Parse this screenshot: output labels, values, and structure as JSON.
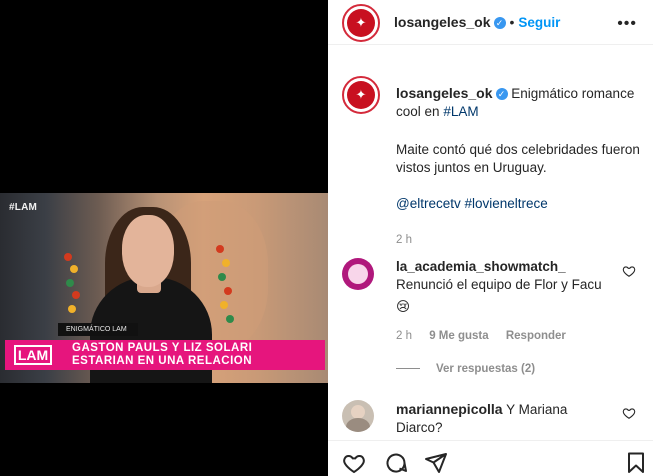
{
  "video": {
    "corner_tag": "#LAM",
    "caption_small": "ENIGMÁTICO LAM",
    "logo_text": "LAM",
    "headline_line1": "GASTON PAULS Y LIZ SOLARI",
    "headline_line2": "ESTARIAN EN UNA RELACION",
    "accent_color": "#e6157d"
  },
  "header": {
    "username": "losangeles_ok",
    "follow_label": "Seguir",
    "more_label": "•••"
  },
  "caption": {
    "username": "losangeles_ok",
    "text_main": "Enigmático romance cool en",
    "hashtag_lam": "#LAM",
    "paragraph2": "Maite contó qué dos celebridades fueron vistos juntos en Uruguay.",
    "mention": "@eltrecetv",
    "hashtag2": "#lovieneltrece",
    "time": "2 h"
  },
  "comments": [
    {
      "username": "la_academia_showmatch_",
      "text": "Renunció el equipo de Flor y Facu",
      "emoji": "😢",
      "time": "2 h",
      "likes": "9 Me gusta",
      "reply_label": "Responder",
      "view_replies": "Ver respuestas (2)"
    },
    {
      "username": "mariannepicolla",
      "text": "Y Mariana Diarco?"
    }
  ],
  "icons": {
    "like": "heart-icon",
    "comment": "comment-icon",
    "share": "send-icon",
    "save": "bookmark-icon",
    "verified": "verified-badge-icon"
  },
  "colors": {
    "link_blue": "#0095f6",
    "brand_red": "#c81020",
    "verified_blue": "#3897f0"
  }
}
